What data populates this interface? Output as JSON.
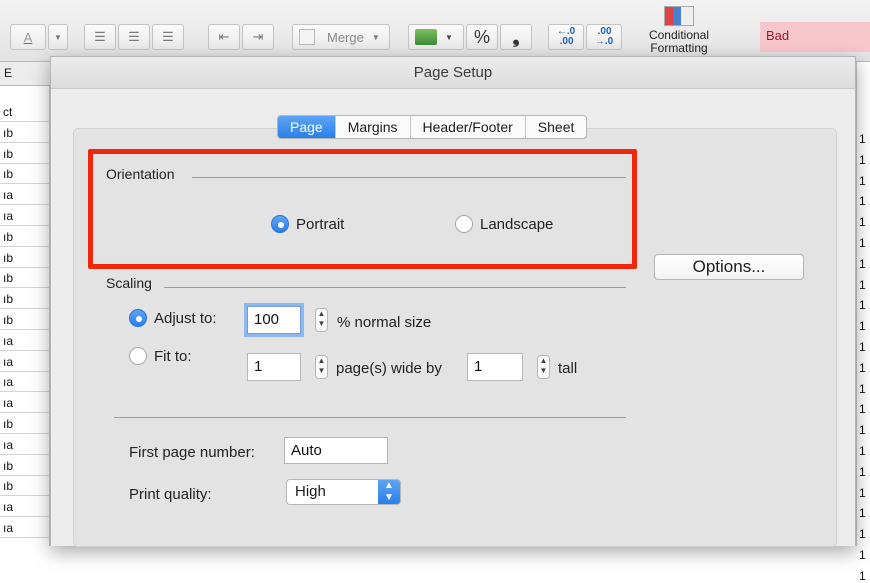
{
  "toolbar": {
    "merge_label": "Merge",
    "percent_symbol": "%",
    "comma_symbol": "❟",
    "decrease_decimal_label": "←.0\n.00",
    "increase_decimal_label": ".00\n→.0",
    "conditional_formatting_label_1": "Conditional",
    "conditional_formatting_label_2": "Formatting",
    "bad_style_label": "Bad"
  },
  "dialog": {
    "title": "Page Setup",
    "tabs": [
      {
        "label": "Page",
        "active": true
      },
      {
        "label": "Margins",
        "active": false
      },
      {
        "label": "Header/Footer",
        "active": false
      },
      {
        "label": "Sheet",
        "active": false
      }
    ],
    "orientation": {
      "label": "Orientation",
      "portrait_label": "Portrait",
      "landscape_label": "Landscape",
      "selected": "Portrait"
    },
    "options_button_label": "Options...",
    "scaling": {
      "label": "Scaling",
      "adjust_to_label": "Adjust to:",
      "adjust_to_value": "100",
      "normal_size_label": "% normal size",
      "fit_to_label": "Fit to:",
      "fit_wide_value": "1",
      "pages_wide_label": "page(s) wide by",
      "fit_tall_value": "1",
      "tall_label": "tall",
      "selected": "Adjust to"
    },
    "first_page_number_label": "First page number:",
    "first_page_number_value": "Auto",
    "print_quality_label": "Print quality:",
    "print_quality_value": "High"
  },
  "sheet": {
    "column_header": "E",
    "row_cells": [
      "ct",
      "ıb",
      "ıb",
      "ıb",
      "ıa",
      "ıa",
      "ıb",
      "ıb",
      "ıb",
      "ıb",
      "ıb",
      "ıa",
      "ıa",
      "ıa",
      "ıa",
      "ıb",
      "ıa",
      "ıb",
      "ıb",
      "ıa",
      "ıa"
    ],
    "right_column_values": [
      "1",
      "1",
      "1",
      "1",
      "1",
      "1",
      "1",
      "1",
      "1",
      "1",
      "1",
      "1",
      "1",
      "1",
      "1",
      "1",
      "1",
      "1",
      "1",
      "1",
      "1",
      "1"
    ]
  },
  "colors": {
    "accent_blue": "#2a7fe8",
    "highlight_red": "#f1270c",
    "bad_fill": "#f8c7cd"
  }
}
